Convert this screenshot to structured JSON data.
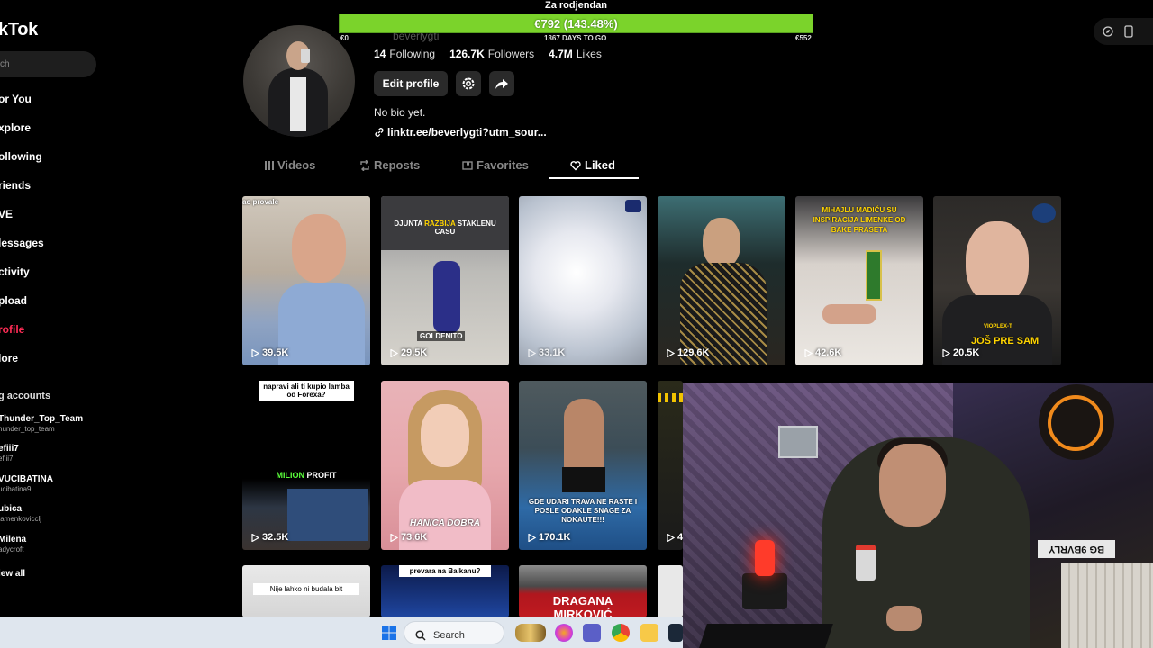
{
  "sidebar": {
    "logo": "kTok",
    "search_placeholder": "ch",
    "nav": [
      {
        "label": "or You",
        "active": false
      },
      {
        "label": "xplore",
        "active": false
      },
      {
        "label": "ollowing",
        "active": false
      },
      {
        "label": "riends",
        "active": false
      },
      {
        "label": "VE",
        "active": false
      },
      {
        "label": "lessages",
        "active": false
      },
      {
        "label": "ctivity",
        "active": false
      },
      {
        "label": "pload",
        "active": false
      },
      {
        "label": "rofile",
        "active": true
      },
      {
        "label": "lore",
        "active": false
      }
    ],
    "section_title": "g accounts",
    "accounts": [
      {
        "name": "Thunder_Top_Team",
        "handle": "hunder_top_team"
      },
      {
        "name": "efiii7",
        "handle": "efiii7"
      },
      {
        "name": "VUCIBATINA",
        "handle": "ucibatina9"
      },
      {
        "name": "ubica",
        "handle": "tamenkovicclj"
      },
      {
        "name": "Milena",
        "handle": "adycroft"
      }
    ],
    "view_all": "iew all"
  },
  "goal": {
    "title": "Za rodjendan",
    "text": "€792 (143.48%)",
    "progress": 1.0,
    "left": "€0",
    "center": "1367 DAYS TO GO",
    "right": "€552"
  },
  "profile": {
    "username": "beverlygti",
    "stats": [
      {
        "value": "14",
        "label": "Following"
      },
      {
        "value": "126.7K",
        "label": "Followers"
      },
      {
        "value": "4.7M",
        "label": "Likes"
      }
    ],
    "edit_label": "Edit profile",
    "bio": "No bio yet.",
    "link": "linktr.ee/beverlygti?utm_sour..."
  },
  "tabs": [
    {
      "label": "Videos",
      "icon": "grid-icon",
      "active": false
    },
    {
      "label": "Reposts",
      "icon": "repost-icon",
      "active": false
    },
    {
      "label": "Favorites",
      "icon": "bookmark-icon",
      "active": false
    },
    {
      "label": "Liked",
      "icon": "heart-icon",
      "active": true
    }
  ],
  "videos": [
    {
      "views": "39.5K",
      "caption": "ao provale"
    },
    {
      "views": "29.5K",
      "caption": "DJUNTA RAZBIJA STAKLENU CASU",
      "sub": "GOLDENITO"
    },
    {
      "views": "33.1K",
      "caption": ""
    },
    {
      "views": "129.6K",
      "caption": ""
    },
    {
      "views": "42.6K",
      "caption": "MIHAJLU MADIĆU SU INSPIRACIJA LIMENKE OD BAKE PRASETA"
    },
    {
      "views": "20.5K",
      "caption": "JOŠ PRE SAM",
      "sub": "VIOPLEX-T"
    },
    {
      "views": "32.5K",
      "caption": "napravi ali ti kupio lamba od Forexa?",
      "sub": "MILION PROFIT"
    },
    {
      "views": "73.6K",
      "caption": "HANICA DOBRA"
    },
    {
      "views": "170.1K",
      "caption": "GDE UDARI TRAVA NE RASTE I POSLE ODAKLE SNAGE ZA NOKAUTE!!!"
    },
    {
      "views": "4",
      "caption": ""
    },
    {
      "views": "",
      "caption": "Nije lahko ni budala bit"
    },
    {
      "views": "",
      "caption": "prevara na Balkanu?"
    },
    {
      "views": "",
      "caption": "DRAGANA MIRKOVIĆ"
    }
  ],
  "webcam": {
    "plate": "BG 9BVRLY"
  },
  "taskbar": {
    "search_label": "Search"
  },
  "colors": {
    "accent": "#fe2c55",
    "goal": "#8ce63a",
    "bg": "#000000"
  }
}
